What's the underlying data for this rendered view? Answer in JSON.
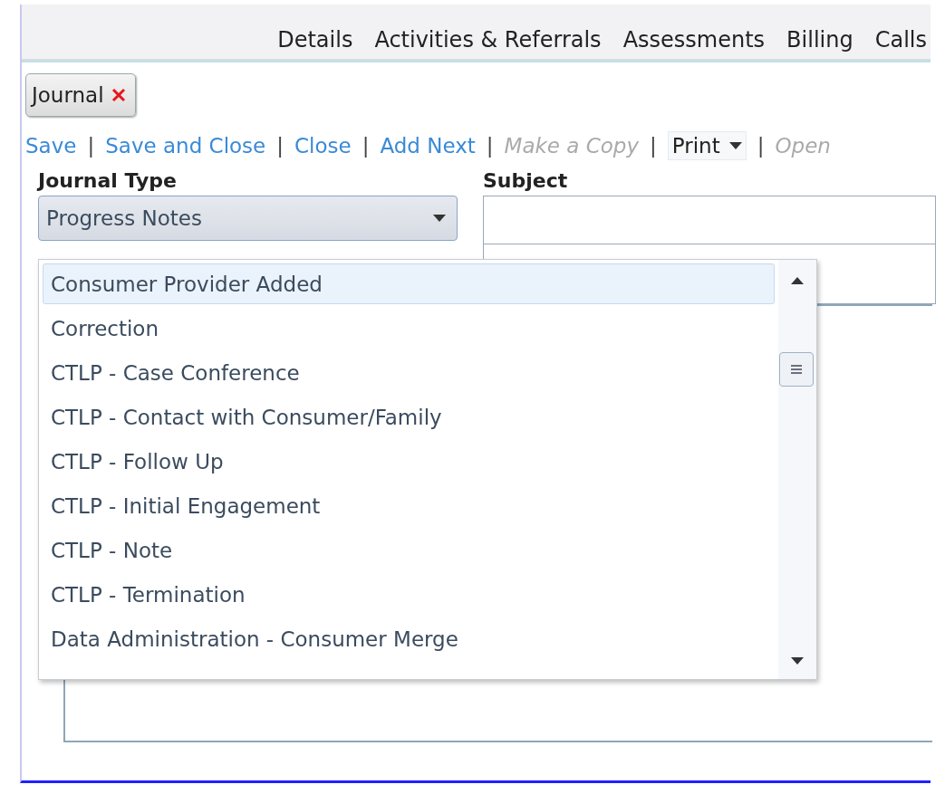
{
  "nav_tabs": [
    {
      "label": "Details"
    },
    {
      "label": "Activities & Referrals"
    },
    {
      "label": "Assessments"
    },
    {
      "label": "Billing"
    },
    {
      "label": "Calls"
    }
  ],
  "open_tabs": [
    {
      "label": "Journal"
    }
  ],
  "toolbar": [
    {
      "kind": "link",
      "label": "Save",
      "disabled": false
    },
    {
      "kind": "separator",
      "label": "|"
    },
    {
      "kind": "link",
      "label": "Save and Close",
      "disabled": false
    },
    {
      "kind": "separator",
      "label": "|"
    },
    {
      "kind": "link",
      "label": "Close",
      "disabled": false
    },
    {
      "kind": "separator",
      "label": "|"
    },
    {
      "kind": "link",
      "label": "Add Next",
      "disabled": false
    },
    {
      "kind": "separator",
      "label": "|"
    },
    {
      "kind": "link",
      "label": "Make a Copy",
      "disabled": true
    },
    {
      "kind": "separator",
      "label": "|"
    },
    {
      "kind": "menu",
      "label": "Print",
      "disabled": false
    },
    {
      "kind": "separator",
      "label": "|"
    },
    {
      "kind": "link",
      "label": "Open",
      "disabled": true
    }
  ],
  "journal_type": {
    "label": "Journal Type",
    "value": "Progress Notes",
    "expanded": true,
    "options": [
      {
        "label": "Consumer Provider Added",
        "selected": true
      },
      {
        "label": "Correction",
        "selected": false
      },
      {
        "label": "CTLP - Case Conference",
        "selected": false
      },
      {
        "label": "CTLP - Contact with Consumer/Family",
        "selected": false
      },
      {
        "label": "CTLP - Follow Up",
        "selected": false
      },
      {
        "label": "CTLP - Initial Engagement",
        "selected": false
      },
      {
        "label": "CTLP - Note",
        "selected": false
      },
      {
        "label": "CTLP - Termination",
        "selected": false
      },
      {
        "label": "Data Administration - Consumer Merge",
        "selected": false
      }
    ]
  },
  "subject": {
    "label": "Subject"
  }
}
